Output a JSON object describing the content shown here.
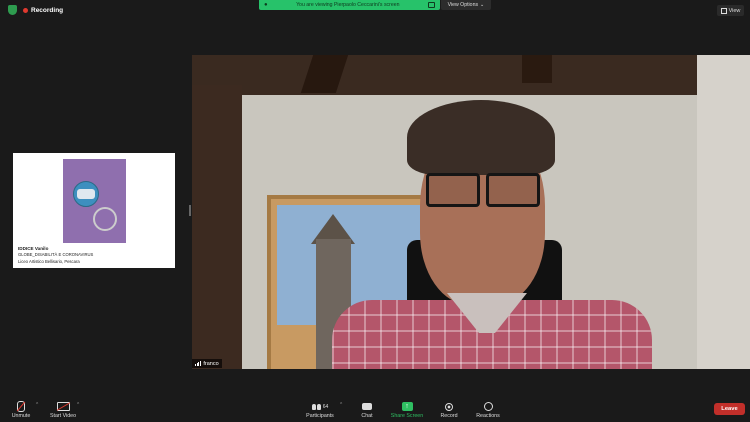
{
  "topbar": {
    "recording_label": "Recording",
    "share_banner_text": "You are viewing Pierpaolo Ceccarini's screen",
    "view_options_label": "View Options",
    "view_label": "View"
  },
  "thumbnail": {
    "line1": "IDDICE Vanilo",
    "line2": "GLOBE_DISABILITÀ E CORONAVIRUS",
    "line3": "Liceo Artistico Bellisario, Pescara"
  },
  "video": {
    "participant_name": "franco"
  },
  "toolbar": {
    "unmute_label": "Unmute",
    "start_video_label": "Start Video",
    "participants_label": "Participants",
    "participants_count": "64",
    "chat_label": "Chat",
    "share_screen_label": "Share Screen",
    "record_label": "Record",
    "reactions_label": "Reactions",
    "leave_label": "Leave"
  },
  "colors": {
    "share_green": "#27c26a",
    "leave_red": "#c22f2a",
    "recording_red": "#e0392f"
  }
}
